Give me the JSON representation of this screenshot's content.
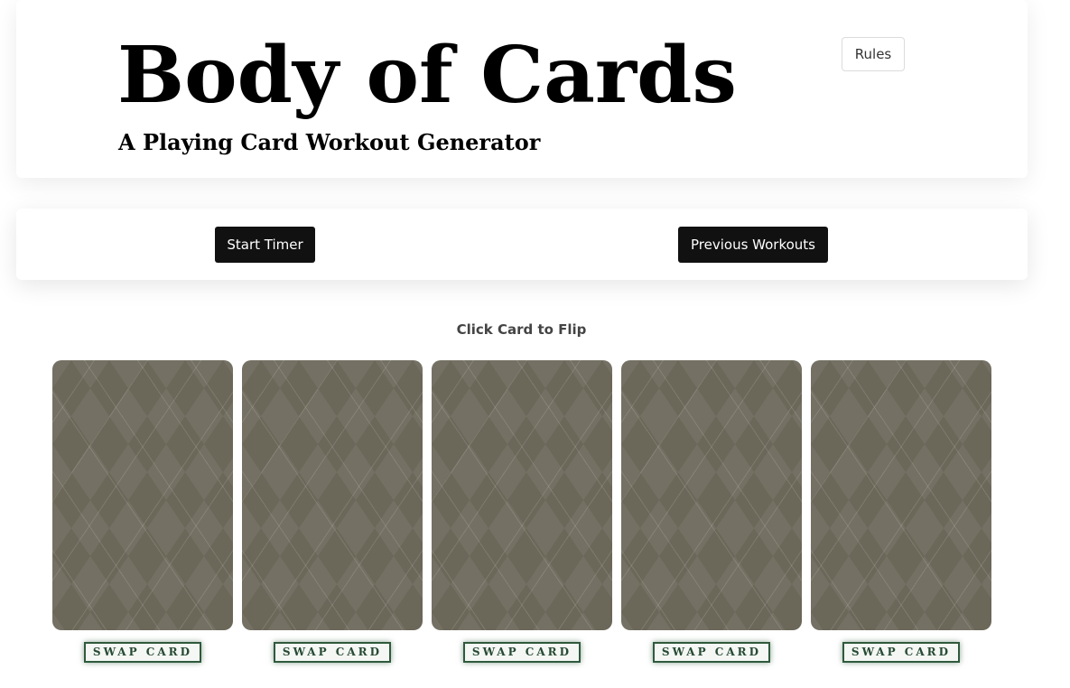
{
  "header": {
    "title": "Body of Cards",
    "subtitle": "A Playing Card Workout Generator",
    "rules_label": "Rules"
  },
  "toolbar": {
    "start_timer_label": "Start Timer",
    "previous_workouts_label": "Previous Workouts"
  },
  "main": {
    "hint": "Click Card to Flip",
    "cards": [
      {
        "swap_label": "SWAP CARD"
      },
      {
        "swap_label": "SWAP CARD"
      },
      {
        "swap_label": "SWAP CARD"
      },
      {
        "swap_label": "SWAP CARD"
      },
      {
        "swap_label": "SWAP CARD"
      }
    ]
  },
  "colors": {
    "card_back": "#6b6759",
    "dark_button": "#111111",
    "swap_border": "#2f5a3c"
  }
}
